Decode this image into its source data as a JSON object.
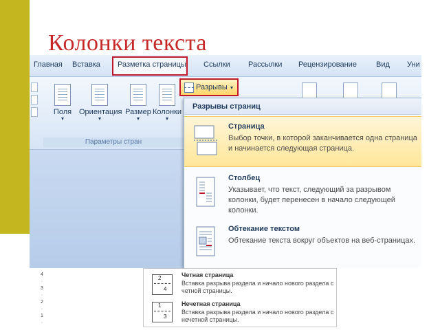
{
  "slide": {
    "title": "Колонки текста"
  },
  "ribbon": {
    "tabs": [
      {
        "label": "Главная"
      },
      {
        "label": "Вставка"
      },
      {
        "label": "Разметка страницы"
      },
      {
        "label": "Ссылки"
      },
      {
        "label": "Рассылки"
      },
      {
        "label": "Рецензирование"
      },
      {
        "label": "Вид"
      },
      {
        "label": "Уни"
      }
    ],
    "buttons": [
      {
        "label": "Поля",
        "icon": "margins-icon"
      },
      {
        "label": "Ориентация",
        "icon": "orientation-icon"
      },
      {
        "label": "Размер",
        "icon": "size-icon"
      },
      {
        "label": "Колонки",
        "icon": "columns-icon"
      }
    ],
    "group_label": "Параметры стран",
    "breaks_label": "Разрывы",
    "breaks_caret": "▾",
    "dropdown_caret": "▾"
  },
  "menu": {
    "header": "Разрывы страниц",
    "items": [
      {
        "title": "Страница",
        "desc": "Выбор точки, в которой заканчивается одна страница и начинается следующая страница.",
        "icon": "page-break-icon",
        "highlighted": true
      },
      {
        "title": "Столбец",
        "desc": "Указывает, что текст, следующий за разрывом колонки, будет перенесен в начало следующей колонки.",
        "icon": "column-break-icon",
        "highlighted": false
      },
      {
        "title": "Обтекание текстом",
        "desc": "Обтекание текста вокруг объектов на веб-страницах.",
        "icon": "text-wrapping-icon",
        "highlighted": false
      }
    ]
  },
  "inset": {
    "items": [
      {
        "title": "Четная страница",
        "desc": "Вставка разрыва раздела и начало нового раздела с четной страницы.",
        "icon_label": "2",
        "icon_label_2": "4"
      },
      {
        "title": "Нечетная страница",
        "desc": "Вставка разрыва раздела и начало нового раздела с нечетной страницы.",
        "icon_label": "1",
        "icon_label_2": "3"
      }
    ],
    "ruler": [
      "4",
      "·",
      "3",
      "·",
      "2",
      "·",
      "1",
      "·"
    ]
  },
  "colors": {
    "accent": "#c0182a",
    "title": "#c62828",
    "ribbon": "#d6e4f5",
    "highlight": "#ffe699",
    "left_bar": "#c3b61e"
  }
}
